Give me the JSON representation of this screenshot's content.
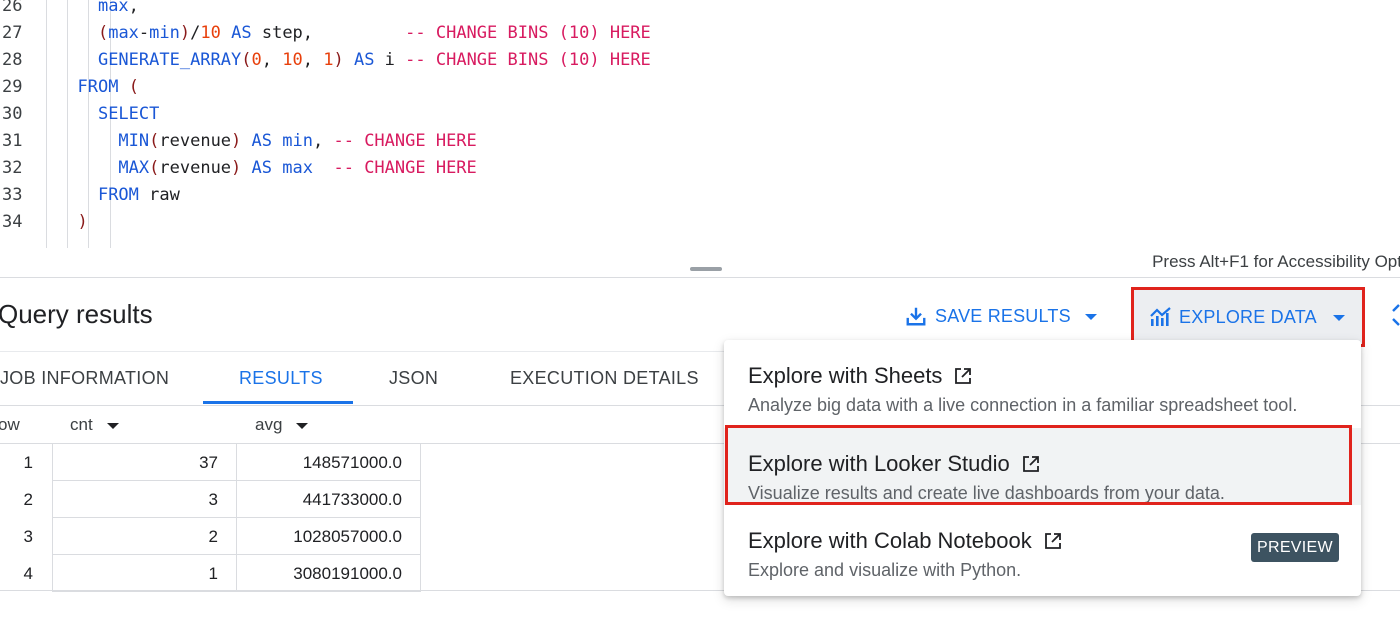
{
  "editor": {
    "lines": [
      {
        "num": "26",
        "indent": "    ",
        "tokens": [
          {
            "t": "max",
            "c": "kw"
          },
          {
            "t": ",",
            "c": "tx"
          }
        ]
      },
      {
        "num": "27",
        "indent": "    ",
        "tokens": [
          {
            "t": "(",
            "c": "pa"
          },
          {
            "t": "max",
            "c": "kw"
          },
          {
            "t": "-",
            "c": "tx"
          },
          {
            "t": "min",
            "c": "kw"
          },
          {
            "t": ")",
            "c": "pa"
          },
          {
            "t": "/",
            "c": "tx"
          },
          {
            "t": "10",
            "c": "num"
          },
          {
            "t": " ",
            "c": "tx"
          },
          {
            "t": "AS",
            "c": "kw"
          },
          {
            "t": " step,         ",
            "c": "tx"
          },
          {
            "t": "-- CHANGE BINS (10) HERE",
            "c": "cm"
          }
        ]
      },
      {
        "num": "28",
        "indent": "    ",
        "tokens": [
          {
            "t": "GENERATE_ARRAY",
            "c": "kw"
          },
          {
            "t": "(",
            "c": "pa"
          },
          {
            "t": "0",
            "c": "num"
          },
          {
            "t": ", ",
            "c": "tx"
          },
          {
            "t": "10",
            "c": "num"
          },
          {
            "t": ", ",
            "c": "tx"
          },
          {
            "t": "1",
            "c": "num"
          },
          {
            "t": ")",
            "c": "pa"
          },
          {
            "t": " ",
            "c": "tx"
          },
          {
            "t": "AS",
            "c": "kw"
          },
          {
            "t": " i ",
            "c": "tx"
          },
          {
            "t": "-- CHANGE BINS (10) HERE",
            "c": "cm"
          }
        ]
      },
      {
        "num": "29",
        "indent": "  ",
        "tokens": [
          {
            "t": "FROM",
            "c": "kw"
          },
          {
            "t": " ",
            "c": "tx"
          },
          {
            "t": "(",
            "c": "pa"
          }
        ]
      },
      {
        "num": "30",
        "indent": "    ",
        "tokens": [
          {
            "t": "SELECT",
            "c": "kw"
          }
        ]
      },
      {
        "num": "31",
        "indent": "      ",
        "tokens": [
          {
            "t": "MIN",
            "c": "kw"
          },
          {
            "t": "(",
            "c": "pa"
          },
          {
            "t": "revenue",
            "c": "tx"
          },
          {
            "t": ")",
            "c": "pa"
          },
          {
            "t": " ",
            "c": "tx"
          },
          {
            "t": "AS",
            "c": "kw"
          },
          {
            "t": " ",
            "c": "tx"
          },
          {
            "t": "min",
            "c": "kw"
          },
          {
            "t": ", ",
            "c": "tx"
          },
          {
            "t": "-- CHANGE HERE",
            "c": "cm"
          }
        ]
      },
      {
        "num": "32",
        "indent": "      ",
        "tokens": [
          {
            "t": "MAX",
            "c": "kw"
          },
          {
            "t": "(",
            "c": "pa"
          },
          {
            "t": "revenue",
            "c": "tx"
          },
          {
            "t": ")",
            "c": "pa"
          },
          {
            "t": " ",
            "c": "tx"
          },
          {
            "t": "AS",
            "c": "kw"
          },
          {
            "t": " ",
            "c": "tx"
          },
          {
            "t": "max",
            "c": "kw"
          },
          {
            "t": "  ",
            "c": "tx"
          },
          {
            "t": "-- CHANGE HERE",
            "c": "cm"
          }
        ]
      },
      {
        "num": "33",
        "indent": "    ",
        "tokens": [
          {
            "t": "FROM",
            "c": "kw"
          },
          {
            "t": " raw",
            "c": "tx"
          }
        ]
      },
      {
        "num": "34",
        "indent": "  ",
        "tokens": [
          {
            "t": ")",
            "c": "pa"
          }
        ]
      }
    ],
    "accessibility_hint": "Press Alt+F1 for Accessibility Opt"
  },
  "results": {
    "title": "Query results",
    "save_label": "SAVE RESULTS",
    "explore_label": "EXPLORE DATA"
  },
  "tabs": [
    {
      "label": "JOB INFORMATION",
      "active": false
    },
    {
      "label": "RESULTS",
      "active": true
    },
    {
      "label": "JSON",
      "active": false
    },
    {
      "label": "EXECUTION DETAILS",
      "active": false
    }
  ],
  "table": {
    "row_header": "ow",
    "columns": [
      "cnt",
      "avg"
    ],
    "rows": [
      {
        "num": "1",
        "cnt": "37",
        "avg": "148571000.0"
      },
      {
        "num": "2",
        "cnt": "3",
        "avg": "441733000.0"
      },
      {
        "num": "3",
        "cnt": "2",
        "avg": "1028057000.0"
      },
      {
        "num": "4",
        "cnt": "1",
        "avg": "3080191000.0"
      }
    ]
  },
  "menu": {
    "items": [
      {
        "title": "Explore with Sheets",
        "desc": "Analyze big data with a live connection in a familiar spreadsheet tool."
      },
      {
        "title": "Explore with Looker Studio",
        "desc": "Visualize results and create live dashboards from your data."
      },
      {
        "title": "Explore with Colab Notebook",
        "desc": "Explore and visualize with Python.",
        "badge": "PREVIEW"
      }
    ]
  },
  "colors": {
    "accent": "#1a73e8",
    "highlight_border": "#e0231c",
    "badge_bg": "#3d5361"
  }
}
